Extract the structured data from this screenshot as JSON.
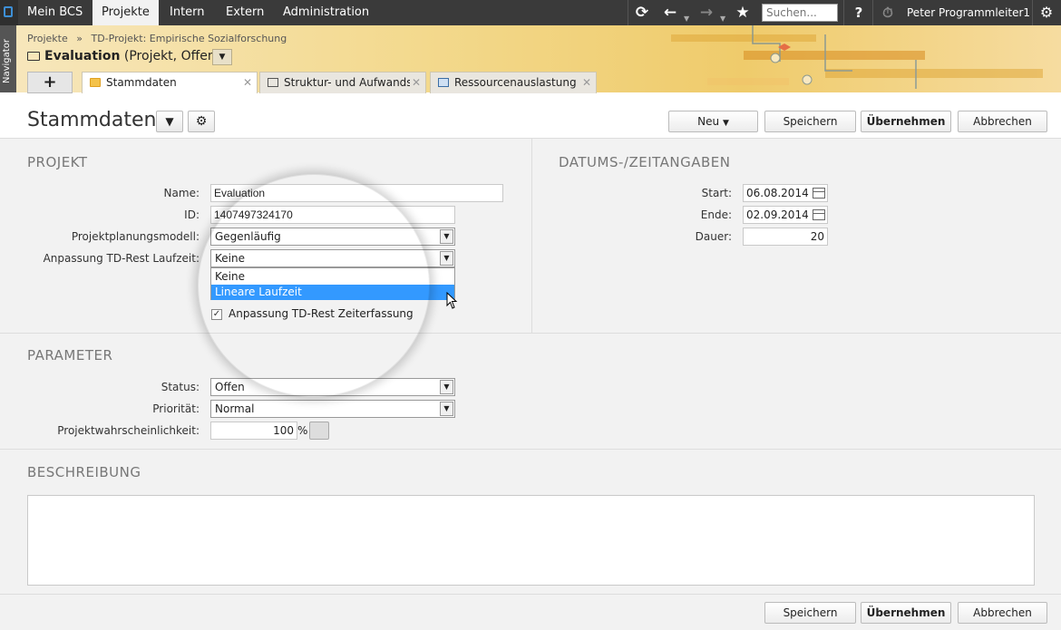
{
  "topbar": {
    "nav": [
      "Mein BCS",
      "Projekte",
      "Intern",
      "Extern",
      "Administration"
    ],
    "active_nav": "Projekte",
    "search_placeholder": "Suchen...",
    "help": "?",
    "user": "Peter Programmleiter1"
  },
  "navigator": {
    "label": "Navigator"
  },
  "breadcrumb": {
    "root": "Projekte",
    "separator": "»",
    "current": "TD-Projekt: Empirische Sozialforschung"
  },
  "project_title": {
    "name": "Evaluation",
    "meta": "(Projekt, Offen)"
  },
  "tabs": [
    {
      "label": "Stammdaten",
      "active": true
    },
    {
      "label": "Struktur- und Aufwandsp",
      "active": false
    },
    {
      "label": "Ressourcenauslastung",
      "active": false
    }
  ],
  "add_tab": "+",
  "page": {
    "title": "Stammdaten"
  },
  "toolbar": {
    "new_label": "Neu",
    "save_label": "Speichern",
    "apply_label": "Übernehmen",
    "cancel_label": "Abbrechen"
  },
  "sections": {
    "projekt": {
      "title": "PROJEKT",
      "name_label": "Name:",
      "name_value": "Evaluation",
      "id_label": "ID:",
      "id_value": "1407497324170",
      "model_label": "Projektplanungsmodell:",
      "model_value": "Gegenläufig",
      "adjust_label": "Anpassung TD-Rest Laufzeit:",
      "adjust_value": "Keine",
      "adjust_options": [
        "Keine",
        "Lineare Laufzeit"
      ],
      "adjust_highlighted": "Lineare Laufzeit",
      "checkbox_label": "Anpassung TD-Rest Zeiterfassung",
      "checkbox_checked": true
    },
    "datum": {
      "title": "DATUMS-/ZEITANGABEN",
      "start_label": "Start:",
      "start_value": "06.08.2014",
      "end_label": "Ende:",
      "end_value": "02.09.2014",
      "duration_label": "Dauer:",
      "duration_value": "20"
    },
    "parameter": {
      "title": "PARAMETER",
      "status_label": "Status:",
      "status_value": "Offen",
      "priority_label": "Priorität:",
      "priority_value": "Normal",
      "probability_label": "Projektwahrscheinlichkeit:",
      "probability_value": "100",
      "probability_unit": "%"
    },
    "beschreibung": {
      "title": "BESCHREIBUNG"
    }
  },
  "colors": {
    "highlight": "#3399ff",
    "topbar": "#3a3a3a",
    "banner": "#efcb6b"
  }
}
